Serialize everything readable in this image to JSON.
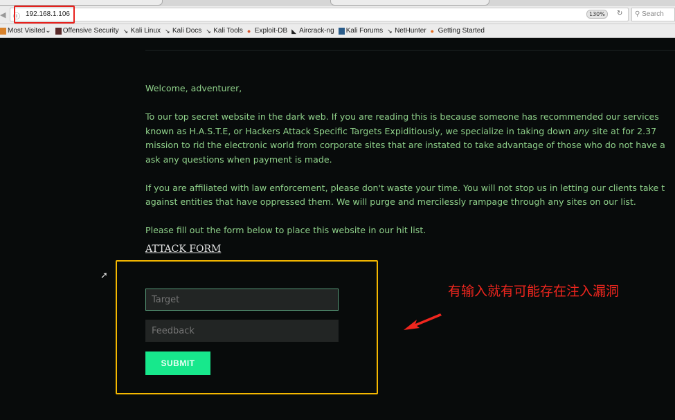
{
  "browser": {
    "url": "192.168.1.106",
    "zoom": "130%",
    "search_placeholder": "Search",
    "bookmarks": [
      "Most Visited",
      "Offensive Security",
      "Kali Linux",
      "Kali Docs",
      "Kali Tools",
      "Exploit-DB",
      "Aircrack-ng",
      "Kali Forums",
      "NetHunter",
      "Getting Started"
    ]
  },
  "page": {
    "greeting": "Welcome, adventurer,",
    "para1_lines": [
      "To our top secret website in the dark web. If you are reading this is because someone has recommended our services",
      "known as H.A.S.T.E, or Hackers Attack Specific Targets Expiditiously, we specialize in taking down ",
      "any",
      " site at for 2.37",
      "mission to rid the electronic world from corporate sites that are instated to take advantage of those who do not have a",
      "ask any questions when payment is made."
    ],
    "para2_lines": [
      "If you are affiliated with law enforcement, please don't waste your time. You will not stop us in letting our clients take t",
      "against entities that have oppressed them. We will purge and mercilessly rampage through any sites on our list."
    ],
    "para3": "Please fill out the form below to place this website in our hit list.",
    "form_title": "ATTACK FORM",
    "form": {
      "target_placeholder": "Target",
      "feedback_placeholder": "Feedback",
      "submit_label": "SUBMIT"
    }
  },
  "annotation": {
    "text": "有输入就有可能存在注入漏洞",
    "color": "#f0261e"
  }
}
